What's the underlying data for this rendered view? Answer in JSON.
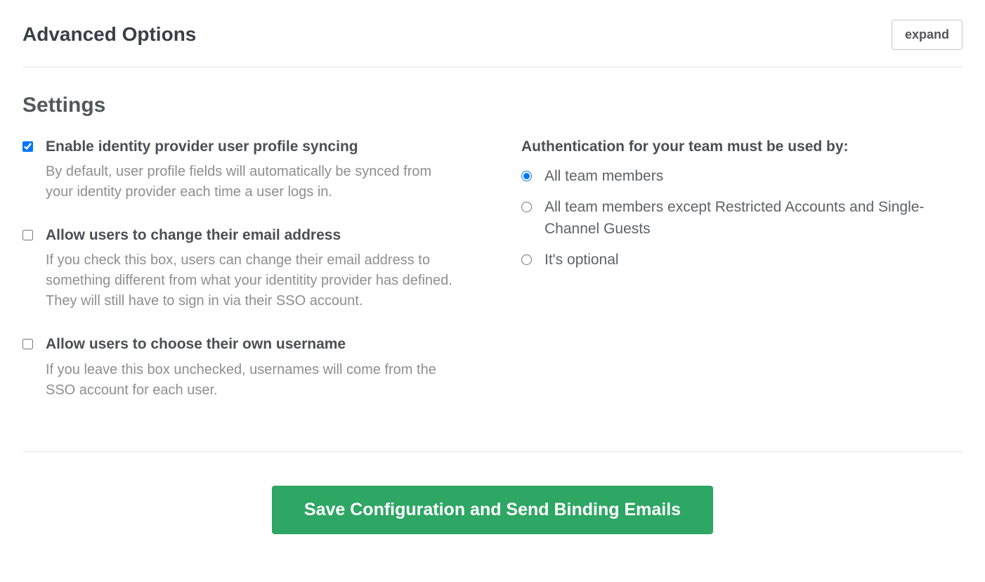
{
  "header": {
    "title": "Advanced Options",
    "expand_label": "expand"
  },
  "settings": {
    "heading": "Settings",
    "checkboxes": [
      {
        "label": "Enable identity provider user profile syncing",
        "description": "By default, user profile fields will automatically be synced from your identity provider each time a user logs in.",
        "checked": true
      },
      {
        "label": "Allow users to change their email address",
        "description": "If you check this box, users can change their email address to something different from what your identitity provider has defined. They will still have to sign in via their SSO account.",
        "checked": false
      },
      {
        "label": "Allow users to choose their own username",
        "description": "If you leave this box unchecked, usernames will come from the SSO account for each user.",
        "checked": false
      }
    ],
    "auth": {
      "heading": "Authentication for your team must be used by:",
      "options": [
        {
          "label": "All team members",
          "selected": true
        },
        {
          "label": "All team members except Restricted Accounts and Single-Channel Guests",
          "selected": false
        },
        {
          "label": "It's optional",
          "selected": false
        }
      ]
    }
  },
  "footer": {
    "save_label": "Save Configuration and Send Binding Emails"
  }
}
